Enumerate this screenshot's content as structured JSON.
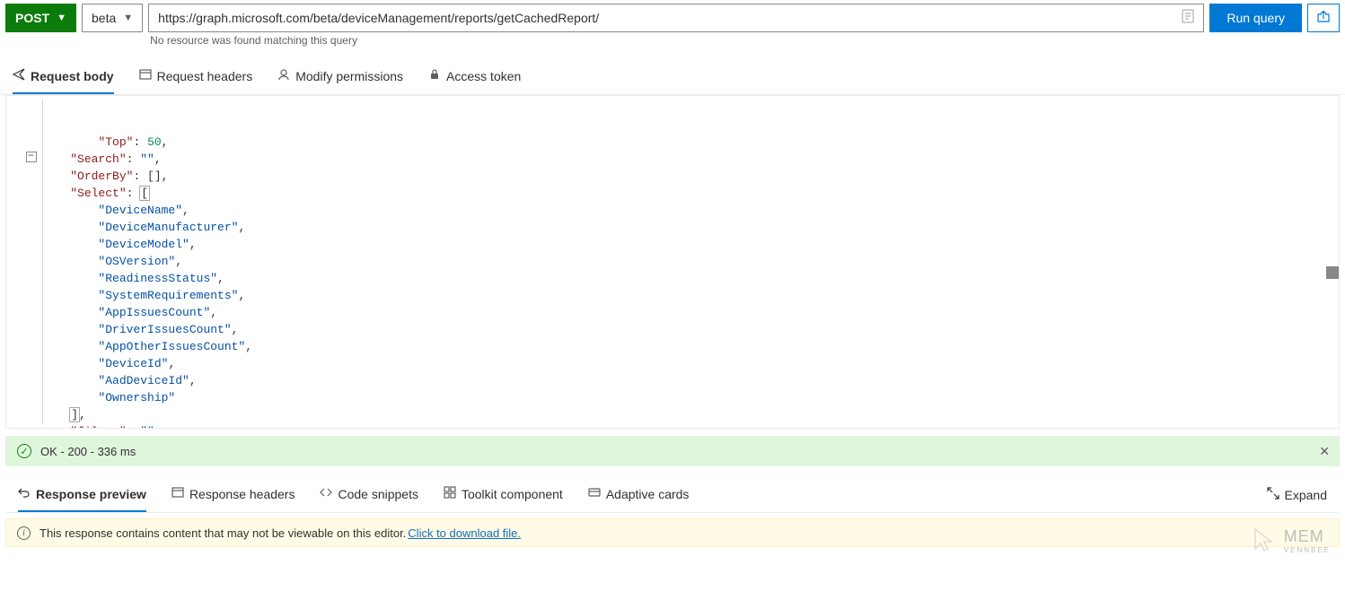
{
  "toolbar": {
    "method": "POST",
    "version": "beta",
    "url": "https://graph.microsoft.com/beta/deviceManagement/reports/getCachedReport/",
    "url_hint": "No resource was found matching this query",
    "run_label": "Run query"
  },
  "request_tabs": {
    "body": "Request body",
    "headers": "Request headers",
    "permissions": "Modify permissions",
    "token": "Access token"
  },
  "request_body": {
    "lines": [
      {
        "indent": 1,
        "key": "Top",
        "value_num": "50",
        "trail": ","
      },
      {
        "indent": 1,
        "key": "Search",
        "value_str": "\"\"",
        "trail": ","
      },
      {
        "indent": 1,
        "key": "OrderBy",
        "raw_after": "[],"
      },
      {
        "indent": 1,
        "key": "Select",
        "raw_after": "[",
        "bracket_hl": true
      },
      {
        "indent": 2,
        "value_str": "\"DeviceName\"",
        "trail": ","
      },
      {
        "indent": 2,
        "value_str": "\"DeviceManufacturer\"",
        "trail": ","
      },
      {
        "indent": 2,
        "value_str": "\"DeviceModel\"",
        "trail": ","
      },
      {
        "indent": 2,
        "value_str": "\"OSVersion\"",
        "trail": ","
      },
      {
        "indent": 2,
        "value_str": "\"ReadinessStatus\"",
        "trail": ","
      },
      {
        "indent": 2,
        "value_str": "\"SystemRequirements\"",
        "trail": ","
      },
      {
        "indent": 2,
        "value_str": "\"AppIssuesCount\"",
        "trail": ","
      },
      {
        "indent": 2,
        "value_str": "\"DriverIssuesCount\"",
        "trail": ","
      },
      {
        "indent": 2,
        "value_str": "\"AppOtherIssuesCount\"",
        "trail": ","
      },
      {
        "indent": 2,
        "value_str": "\"DeviceId\"",
        "trail": ","
      },
      {
        "indent": 2,
        "value_str": "\"AadDeviceId\"",
        "trail": ","
      },
      {
        "indent": 2,
        "value_str": "\"Ownership\""
      },
      {
        "indent": 1,
        "raw": "],",
        "close_hl": true
      },
      {
        "indent": 1,
        "key": "filter",
        "value_str": "\"\""
      },
      {
        "indent": 0,
        "raw": "}"
      }
    ]
  },
  "status": {
    "text": "OK - 200 - 336 ms"
  },
  "response_tabs": {
    "preview": "Response preview",
    "headers": "Response headers",
    "snippets": "Code snippets",
    "toolkit": "Toolkit component",
    "adaptive": "Adaptive cards",
    "expand": "Expand"
  },
  "warning": {
    "text": "This response contains content that may not be viewable on this editor. ",
    "link": "Click to download file."
  },
  "watermark": {
    "top": "MEM",
    "bottom": "VENNBEE"
  }
}
